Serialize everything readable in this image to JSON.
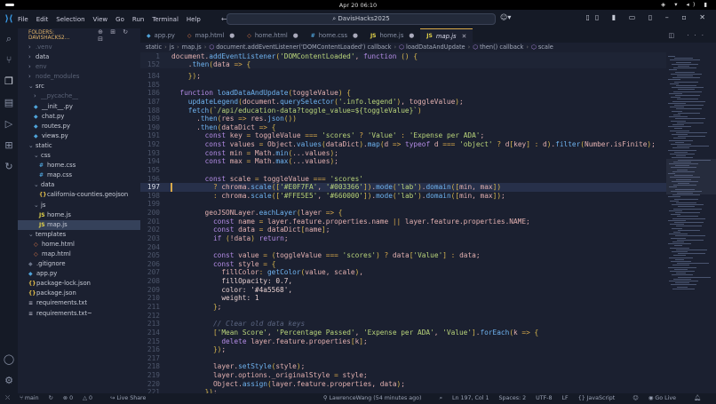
{
  "os": {
    "clock": "Apr 20  06:10"
  },
  "titlebar": {
    "menu": [
      "File",
      "Edit",
      "Selection",
      "View",
      "Go",
      "Run",
      "Terminal",
      "Help"
    ],
    "search": "DavisHacks2025"
  },
  "sidebar": {
    "header": "FOLDERS: DAVISHACKS2...",
    "tree": [
      {
        "label": ".venv",
        "depth": 0,
        "type": "folder",
        "open": false,
        "dim": true
      },
      {
        "label": "data",
        "depth": 0,
        "type": "folder",
        "open": false
      },
      {
        "label": "env",
        "depth": 0,
        "type": "folder",
        "open": false,
        "dim": true
      },
      {
        "label": "node_modules",
        "depth": 0,
        "type": "folder",
        "open": false,
        "dim": true
      },
      {
        "label": "src",
        "depth": 0,
        "type": "folder",
        "open": true
      },
      {
        "label": "__pycache__",
        "depth": 1,
        "type": "folder",
        "open": false,
        "dim": true
      },
      {
        "label": "__init__.py",
        "depth": 1,
        "type": "py"
      },
      {
        "label": "chat.py",
        "depth": 1,
        "type": "py"
      },
      {
        "label": "routes.py",
        "depth": 1,
        "type": "py"
      },
      {
        "label": "views.py",
        "depth": 1,
        "type": "py"
      },
      {
        "label": "static",
        "depth": 0,
        "type": "folder",
        "open": true
      },
      {
        "label": "css",
        "depth": 1,
        "type": "folder",
        "open": true
      },
      {
        "label": "home.css",
        "depth": 2,
        "type": "css"
      },
      {
        "label": "map.css",
        "depth": 2,
        "type": "css"
      },
      {
        "label": "data",
        "depth": 1,
        "type": "folder",
        "open": true
      },
      {
        "label": "california-counties.geojson",
        "depth": 2,
        "type": "json"
      },
      {
        "label": "js",
        "depth": 1,
        "type": "folder",
        "open": true
      },
      {
        "label": "home.js",
        "depth": 2,
        "type": "js"
      },
      {
        "label": "map.js",
        "depth": 2,
        "type": "js",
        "selected": true
      },
      {
        "label": "templates",
        "depth": 0,
        "type": "folder",
        "open": true
      },
      {
        "label": "home.html",
        "depth": 1,
        "type": "html"
      },
      {
        "label": "map.html",
        "depth": 1,
        "type": "html"
      },
      {
        "label": ".gitignore",
        "depth": 0,
        "type": "git"
      },
      {
        "label": "app.py",
        "depth": 0,
        "type": "py"
      },
      {
        "label": "package-lock.json",
        "depth": 0,
        "type": "json"
      },
      {
        "label": "package.json",
        "depth": 0,
        "type": "json"
      },
      {
        "label": "requirements.txt",
        "depth": 0,
        "type": "txt"
      },
      {
        "label": "requirements.txt~",
        "depth": 0,
        "type": "txt"
      }
    ]
  },
  "tabs": [
    {
      "label": "app.py",
      "type": "py"
    },
    {
      "label": "map.html",
      "type": "html",
      "modified": true
    },
    {
      "label": "home.html",
      "type": "html",
      "modified": true
    },
    {
      "label": "home.css",
      "type": "css",
      "modified": true
    },
    {
      "label": "home.js",
      "type": "js",
      "modified": true
    },
    {
      "label": "map.js",
      "type": "js",
      "active": true
    }
  ],
  "breadcrumbs": [
    "static",
    "js",
    "map.js",
    "document.addEventListener('DOMContentLoaded') callback",
    "loadDataAndUpdate",
    "then() callback",
    "scale"
  ],
  "code": {
    "current_line": 197,
    "lines": [
      {
        "n": "1",
        "t": "document.addEventListener('DOMContentLoaded', function () {",
        "sticky": true
      },
      {
        "n": "152",
        "t": "    .then(data => {",
        "sticky": true
      },
      {
        "n": "184",
        "t": "    });"
      },
      {
        "n": "185",
        "t": ""
      },
      {
        "n": "186",
        "t": "  function loadDataAndUpdate(toggleValue) {"
      },
      {
        "n": "187",
        "t": "    updateLegend(document.querySelector('.info.legend'), toggleValue);"
      },
      {
        "n": "188",
        "t": "    fetch(`/api/education-data?toggle_value=${toggleValue}`)"
      },
      {
        "n": "189",
        "t": "      .then(res => res.json())"
      },
      {
        "n": "190",
        "t": "      .then(dataDict => {"
      },
      {
        "n": "191",
        "t": "        const key = toggleValue === 'scores' ? 'Value' : 'Expense per ADA';"
      },
      {
        "n": "192",
        "t": "        const values = Object.values(dataDict).map(d => typeof d === 'object' ? d[key] : d).filter(Number.isFinite);"
      },
      {
        "n": "193",
        "t": "        const min = Math.min(...values);"
      },
      {
        "n": "194",
        "t": "        const max = Math.max(...values);"
      },
      {
        "n": "195",
        "t": ""
      },
      {
        "n": "196",
        "t": "        const scale = toggleValue === 'scores'"
      },
      {
        "n": "197",
        "t": "          ? chroma.scale(['#E0F7FA', '#003366']).mode('lab').domain([min, max])"
      },
      {
        "n": "198",
        "t": "          : chroma.scale(['#FFE5E5', '#660000']).mode('lab').domain([min, max]);"
      },
      {
        "n": "199",
        "t": ""
      },
      {
        "n": "200",
        "t": "        geoJSONLayer.eachLayer(layer => {"
      },
      {
        "n": "201",
        "t": "          const name = layer.feature.properties.name || layer.feature.properties.NAME;"
      },
      {
        "n": "202",
        "t": "          const data = dataDict[name];"
      },
      {
        "n": "203",
        "t": "          if (!data) return;"
      },
      {
        "n": "204",
        "t": ""
      },
      {
        "n": "205",
        "t": "          const value = (toggleValue === 'scores') ? data['Value'] : data;"
      },
      {
        "n": "206",
        "t": "          const style = {"
      },
      {
        "n": "207",
        "t": "            fillColor: getColor(value, scale),"
      },
      {
        "n": "208",
        "t": "            fillOpacity: 0.7,"
      },
      {
        "n": "209",
        "t": "            color: '#4a5568',"
      },
      {
        "n": "210",
        "t": "            weight: 1"
      },
      {
        "n": "211",
        "t": "          };"
      },
      {
        "n": "212",
        "t": ""
      },
      {
        "n": "213",
        "t": "          // Clear old data keys"
      },
      {
        "n": "214",
        "t": "          ['Mean Score', 'Percentage Passed', 'Expense per ADA', 'Value'].forEach(k => {"
      },
      {
        "n": "215",
        "t": "            delete layer.feature.properties[k];"
      },
      {
        "n": "216",
        "t": "          });"
      },
      {
        "n": "217",
        "t": ""
      },
      {
        "n": "218",
        "t": "          layer.setStyle(style);"
      },
      {
        "n": "219",
        "t": "          layer.options._originalStyle = style;"
      },
      {
        "n": "220",
        "t": "          Object.assign(layer.feature.properties, data);"
      },
      {
        "n": "221",
        "t": "        });"
      }
    ]
  },
  "status": {
    "branch": "main",
    "errors": "0",
    "warnings": "0",
    "live_share": "Live Share",
    "blame": "LawrenceWang (54 minutes ago)",
    "position": "Ln 197, Col 1",
    "spaces": "Spaces: 2",
    "encoding": "UTF-8",
    "eol": "LF",
    "language": "JavaScript",
    "go_live": "Go Live"
  },
  "colors": {
    "accent": "#d9a94a",
    "py": "#4fa3d9",
    "js": "#e6d64a",
    "css": "#4fa3d9",
    "html": "#e07a4a",
    "json": "#e6c04a"
  }
}
